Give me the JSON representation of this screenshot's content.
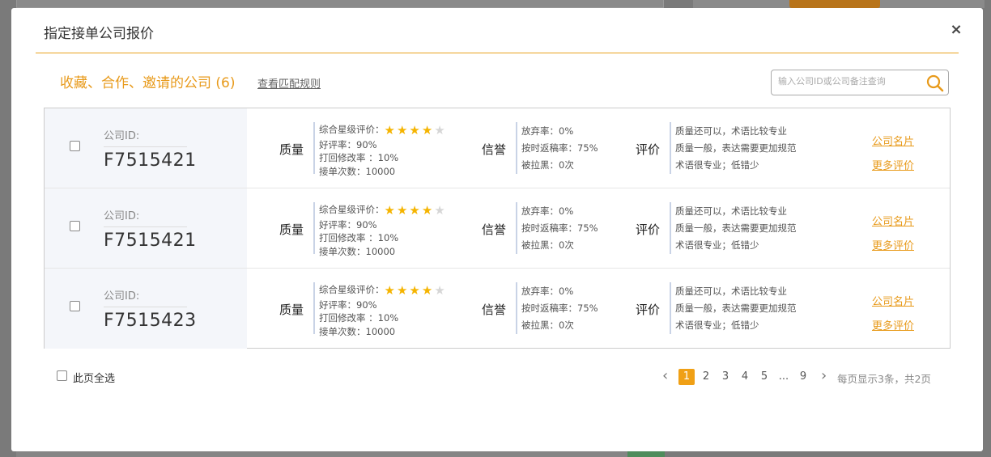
{
  "modal": {
    "title": "指定接单公司报价",
    "close_label": "×"
  },
  "section": {
    "title": "收藏、合作、邀请的公司 (6)",
    "match_rule_label": "查看匹配规则"
  },
  "search": {
    "placeholder": "输入公司ID或公司备注查询",
    "icon": "search-icon"
  },
  "rows": [
    {
      "id_label": "公司ID:",
      "company_id": "F7515421",
      "quality_label": "质量",
      "star_label": "综合星级评价：",
      "stars": 4,
      "good_rate": "好评率：90%",
      "revise_rate": "打回修改率 ：10%",
      "orders": "接单次数：10000",
      "credit_label": "信誉",
      "abandon_rate": "放弃率：0%",
      "on_time_rate": "按时返稿率：75%",
      "blacklisted": "被拉黑：0次",
      "review_label": "评价",
      "reviews": [
        "质量还可以，术语比较专业",
        "质量一般，表达需要更加规范",
        "术语很专业；低错少"
      ],
      "card_link": "公司名片",
      "more_link": "更多评价"
    },
    {
      "id_label": "公司ID:",
      "company_id": "F7515421",
      "quality_label": "质量",
      "star_label": "综合星级评价：",
      "stars": 4,
      "good_rate": "好评率：90%",
      "revise_rate": "打回修改率 ：10%",
      "orders": "接单次数：10000",
      "credit_label": "信誉",
      "abandon_rate": "放弃率：0%",
      "on_time_rate": "按时返稿率：75%",
      "blacklisted": "被拉黑：0次",
      "review_label": "评价",
      "reviews": [
        "质量还可以，术语比较专业",
        "质量一般，表达需要更加规范",
        "术语很专业；低错少"
      ],
      "card_link": "公司名片",
      "more_link": "更多评价"
    },
    {
      "id_label": "公司ID:",
      "company_id": "F7515423",
      "quality_label": "质量",
      "star_label": "综合星级评价：",
      "stars": 4,
      "good_rate": "好评率：90%",
      "revise_rate": "打回修改率 ：10%",
      "orders": "接单次数：10000",
      "credit_label": "信誉",
      "abandon_rate": "放弃率：0%",
      "on_time_rate": "按时返稿率：75%",
      "blacklisted": "被拉黑：0次",
      "review_label": "评价",
      "reviews": [
        "质量还可以，术语比较专业",
        "质量一般，表达需要更加规范",
        "术语很专业；低错少"
      ],
      "card_link": "公司名片",
      "more_link": "更多评价"
    }
  ],
  "footer": {
    "select_all_label": "此页全选"
  },
  "pagination": {
    "prev": "‹",
    "next": "›",
    "pages": [
      "1",
      "2",
      "3",
      "4",
      "5",
      "...",
      "9"
    ],
    "current": "1",
    "info": "每页显示3条，共2页"
  },
  "colors": {
    "accent": "#e89a1a",
    "star": "#f5b400"
  }
}
